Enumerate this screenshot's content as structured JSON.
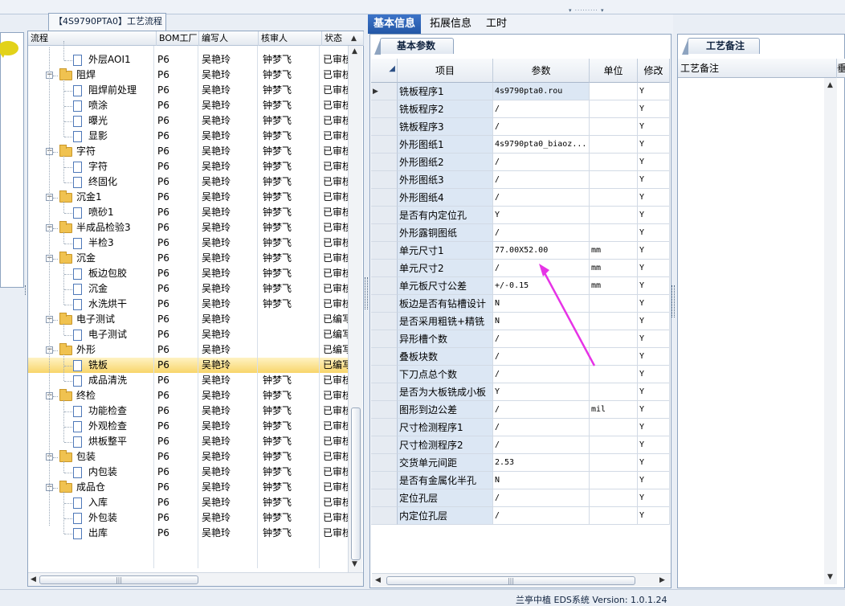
{
  "top_grip": "▾ ········· ▾",
  "left_tab": "【4S9790PTA0】工艺流程",
  "tree": {
    "columns": [
      "流程",
      "BOM工厂",
      "编写人",
      "核审人",
      "状态"
    ],
    "rows": [
      {
        "level": 2,
        "label": "外层AOI1",
        "bom": "P6",
        "writer": "吴艳玲",
        "reviewer": "钟梦飞",
        "status": "已审核",
        "last": false
      },
      {
        "level": 1,
        "label": "阻焊",
        "bom": "P6",
        "writer": "吴艳玲",
        "reviewer": "钟梦飞",
        "status": "已审核"
      },
      {
        "level": 2,
        "label": "阻焊前处理",
        "bom": "P6",
        "writer": "吴艳玲",
        "reviewer": "钟梦飞",
        "status": "已审核",
        "last": false
      },
      {
        "level": 2,
        "label": "喷涂",
        "bom": "P6",
        "writer": "吴艳玲",
        "reviewer": "钟梦飞",
        "status": "已审核",
        "last": false
      },
      {
        "level": 2,
        "label": "曝光",
        "bom": "P6",
        "writer": "吴艳玲",
        "reviewer": "钟梦飞",
        "status": "已审核",
        "last": false
      },
      {
        "level": 2,
        "label": "显影",
        "bom": "P6",
        "writer": "吴艳玲",
        "reviewer": "钟梦飞",
        "status": "已审核",
        "last": true
      },
      {
        "level": 1,
        "label": "字符",
        "bom": "P6",
        "writer": "吴艳玲",
        "reviewer": "钟梦飞",
        "status": "已审核"
      },
      {
        "level": 2,
        "label": "字符",
        "bom": "P6",
        "writer": "吴艳玲",
        "reviewer": "钟梦飞",
        "status": "已审核",
        "last": false
      },
      {
        "level": 2,
        "label": "终固化",
        "bom": "P6",
        "writer": "吴艳玲",
        "reviewer": "钟梦飞",
        "status": "已审核",
        "last": true
      },
      {
        "level": 1,
        "label": "沉金1",
        "bom": "P6",
        "writer": "吴艳玲",
        "reviewer": "钟梦飞",
        "status": "已审核"
      },
      {
        "level": 2,
        "label": "喷砂1",
        "bom": "P6",
        "writer": "吴艳玲",
        "reviewer": "钟梦飞",
        "status": "已审核",
        "last": true
      },
      {
        "level": 1,
        "label": "半成品检验3",
        "bom": "P6",
        "writer": "吴艳玲",
        "reviewer": "钟梦飞",
        "status": "已审核"
      },
      {
        "level": 2,
        "label": "半检3",
        "bom": "P6",
        "writer": "吴艳玲",
        "reviewer": "钟梦飞",
        "status": "已审核",
        "last": true
      },
      {
        "level": 1,
        "label": "沉金",
        "bom": "P6",
        "writer": "吴艳玲",
        "reviewer": "钟梦飞",
        "status": "已审核"
      },
      {
        "level": 2,
        "label": "板边包胶",
        "bom": "P6",
        "writer": "吴艳玲",
        "reviewer": "钟梦飞",
        "status": "已审核",
        "last": false
      },
      {
        "level": 2,
        "label": "沉金",
        "bom": "P6",
        "writer": "吴艳玲",
        "reviewer": "钟梦飞",
        "status": "已审核",
        "last": false
      },
      {
        "level": 2,
        "label": "水洗烘干",
        "bom": "P6",
        "writer": "吴艳玲",
        "reviewer": "钟梦飞",
        "status": "已审核",
        "last": true
      },
      {
        "level": 1,
        "label": "电子测试",
        "bom": "P6",
        "writer": "吴艳玲",
        "reviewer": "",
        "status": "已编写"
      },
      {
        "level": 2,
        "label": "电子测试",
        "bom": "P6",
        "writer": "吴艳玲",
        "reviewer": "",
        "status": "已编写",
        "last": true
      },
      {
        "level": 1,
        "label": "外形",
        "bom": "P6",
        "writer": "吴艳玲",
        "reviewer": "",
        "status": "已编写"
      },
      {
        "level": 2,
        "label": "铣板",
        "bom": "P6",
        "writer": "吴艳玲",
        "reviewer": "",
        "status": "已编写",
        "last": false,
        "selected": true
      },
      {
        "level": 2,
        "label": "成品清洗",
        "bom": "P6",
        "writer": "吴艳玲",
        "reviewer": "钟梦飞",
        "status": "已审核",
        "last": true
      },
      {
        "level": 1,
        "label": "终检",
        "bom": "P6",
        "writer": "吴艳玲",
        "reviewer": "钟梦飞",
        "status": "已审核"
      },
      {
        "level": 2,
        "label": "功能检查",
        "bom": "P6",
        "writer": "吴艳玲",
        "reviewer": "钟梦飞",
        "status": "已审核",
        "last": false
      },
      {
        "level": 2,
        "label": "外观检查",
        "bom": "P6",
        "writer": "吴艳玲",
        "reviewer": "钟梦飞",
        "status": "已审核",
        "last": false
      },
      {
        "level": 2,
        "label": "烘板整平",
        "bom": "P6",
        "writer": "吴艳玲",
        "reviewer": "钟梦飞",
        "status": "已审核",
        "last": true
      },
      {
        "level": 1,
        "label": "包装",
        "bom": "P6",
        "writer": "吴艳玲",
        "reviewer": "钟梦飞",
        "status": "已审核"
      },
      {
        "level": 2,
        "label": "内包装",
        "bom": "P6",
        "writer": "吴艳玲",
        "reviewer": "钟梦飞",
        "status": "已审核",
        "last": true
      },
      {
        "level": 1,
        "label": "成品仓",
        "bom": "P6",
        "writer": "吴艳玲",
        "reviewer": "钟梦飞",
        "status": "已审核"
      },
      {
        "level": 2,
        "label": "入库",
        "bom": "P6",
        "writer": "吴艳玲",
        "reviewer": "钟梦飞",
        "status": "已审核",
        "last": false
      },
      {
        "level": 2,
        "label": "外包装",
        "bom": "P6",
        "writer": "吴艳玲",
        "reviewer": "钟梦飞",
        "status": "已审核",
        "last": false
      },
      {
        "level": 2,
        "label": "出库",
        "bom": "P6",
        "writer": "吴艳玲",
        "reviewer": "钟梦飞",
        "status": "已审核",
        "last": true
      }
    ]
  },
  "mid_tabs": [
    "基本信息",
    "拓展信息",
    "工时"
  ],
  "mid_subtab": "基本参数",
  "params": {
    "columns": [
      "项目",
      "参数",
      "单位",
      "修改"
    ],
    "rows": [
      {
        "item": "铣板程序1",
        "value": "4s9790pta0.rou",
        "unit": "",
        "mod": "Y",
        "current": true
      },
      {
        "item": "铣板程序2",
        "value": "/",
        "unit": "",
        "mod": "Y"
      },
      {
        "item": "铣板程序3",
        "value": "/",
        "unit": "",
        "mod": "Y"
      },
      {
        "item": "外形图纸1",
        "value": "4s9790pta0_biaoz...",
        "unit": "",
        "mod": "Y"
      },
      {
        "item": "外形图纸2",
        "value": "/",
        "unit": "",
        "mod": "Y"
      },
      {
        "item": "外形图纸3",
        "value": "/",
        "unit": "",
        "mod": "Y"
      },
      {
        "item": "外形图纸4",
        "value": "/",
        "unit": "",
        "mod": "Y"
      },
      {
        "item": "是否有内定位孔",
        "value": "Y",
        "unit": "",
        "mod": "Y"
      },
      {
        "item": "外形露铜图纸",
        "value": "/",
        "unit": "",
        "mod": "Y"
      },
      {
        "item": "单元尺寸1",
        "value": "77.00X52.00",
        "unit": "mm",
        "mod": "Y"
      },
      {
        "item": "单元尺寸2",
        "value": "/",
        "unit": "mm",
        "mod": "Y"
      },
      {
        "item": "单元板尺寸公差",
        "value": "+/-0.15",
        "unit": "mm",
        "mod": "Y"
      },
      {
        "item": "板边是否有钻槽设计",
        "value": "N",
        "unit": "",
        "mod": "Y"
      },
      {
        "item": "是否采用粗铣+精铣",
        "value": "N",
        "unit": "",
        "mod": "Y"
      },
      {
        "item": "异形槽个数",
        "value": "/",
        "unit": "",
        "mod": "Y"
      },
      {
        "item": "叠板块数",
        "value": "/",
        "unit": "",
        "mod": "Y"
      },
      {
        "item": "下刀点总个数",
        "value": "/",
        "unit": "",
        "mod": "Y"
      },
      {
        "item": "是否为大板铣成小板",
        "value": "Y",
        "unit": "",
        "mod": "Y"
      },
      {
        "item": "图形到边公差",
        "value": "/",
        "unit": "mil",
        "mod": "Y"
      },
      {
        "item": "尺寸检测程序1",
        "value": "/",
        "unit": "",
        "mod": "Y"
      },
      {
        "item": "尺寸检测程序2",
        "value": "/",
        "unit": "",
        "mod": "Y"
      },
      {
        "item": "交货单元间距",
        "value": "2.53",
        "unit": "",
        "mod": "Y"
      },
      {
        "item": "是否有金属化半孔",
        "value": "N",
        "unit": "",
        "mod": "Y"
      },
      {
        "item": "定位孔层",
        "value": "/",
        "unit": "",
        "mod": "Y"
      },
      {
        "item": "内定位孔层",
        "value": "/",
        "unit": "",
        "mod": "Y"
      }
    ]
  },
  "right": {
    "tab": "工艺备注",
    "header": "工艺备注",
    "header2": "垂"
  },
  "status_text": "兰亭中植 EDS系统 Version: 1.0.1.24",
  "annotation_color": "#e633e6"
}
